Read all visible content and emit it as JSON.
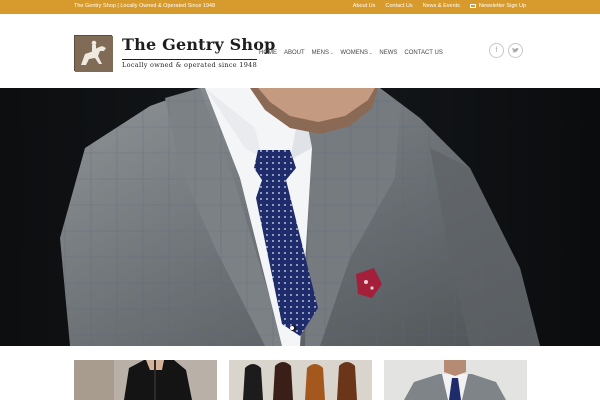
{
  "topbar": {
    "tagline": "The Gentry Shop | Locally Owned & Operated Since 1948",
    "links": [
      "About Us",
      "Contact Us",
      "News & Events",
      "Newsletter Sign Up"
    ],
    "bg_color": "#d79a2d"
  },
  "logo": {
    "title": "The Gentry Shop",
    "subtitle": "Locally owned & operated since 1948",
    "emblem": "horse-rider-logo"
  },
  "nav": {
    "items": [
      "HOME",
      "ABOUT",
      "MENS",
      "WOMENS",
      "NEWS",
      "CONTACT US"
    ]
  },
  "social": {
    "facebook": "f",
    "twitter": "twitter-icon"
  },
  "hero": {
    "image": "man-in-grey-plaid-suit-with-navy-polka-dot-tie",
    "slider_dot": "slide-indicator"
  },
  "thumbs": [
    {
      "image": "woman-in-black-outfit"
    },
    {
      "image": "mens-dress-shoes"
    },
    {
      "image": "man-in-grey-suit"
    }
  ]
}
